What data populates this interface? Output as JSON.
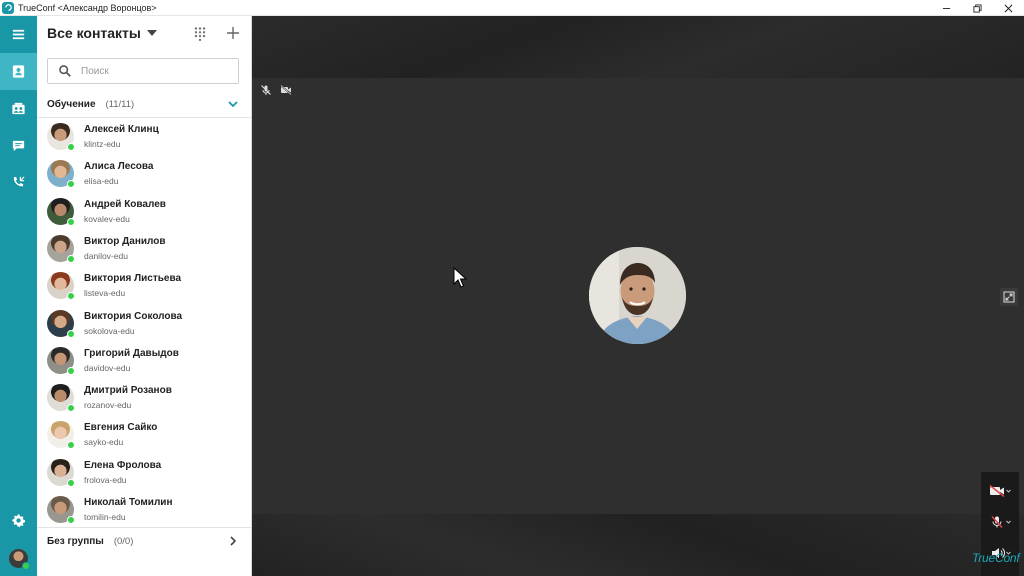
{
  "window": {
    "title": "TrueConf <Александр Воронцов>",
    "icons": [
      "trueconf-app-icon",
      "minimize-icon",
      "restore-icon",
      "close-icon"
    ]
  },
  "rail": {
    "items": [
      "menu-icon",
      "contacts-icon",
      "conferences-icon",
      "chat-icon",
      "call-history-icon",
      "settings-icon"
    ],
    "active": "contacts-icon",
    "accent": "#1a97a6",
    "active_bg": "#3eb6c4"
  },
  "contacts": {
    "header_title": "Все контакты",
    "search_placeholder": "Поиск",
    "groups": [
      {
        "name": "Обучение",
        "count": "(11/11)",
        "expanded": true
      },
      {
        "name": "Без группы",
        "count": "(0/0)",
        "expanded": false
      }
    ],
    "items": [
      {
        "name": "Алексей Клинц",
        "login": "klintz-edu",
        "status": "online"
      },
      {
        "name": "Алиса Лесова",
        "login": "elisa-edu",
        "status": "online"
      },
      {
        "name": "Андрей Ковалев",
        "login": "kovalev-edu",
        "status": "online"
      },
      {
        "name": "Виктор Данилов",
        "login": "danilov-edu",
        "status": "online"
      },
      {
        "name": "Виктория Листьева",
        "login": "listeva-edu",
        "status": "online"
      },
      {
        "name": "Виктория Соколова",
        "login": "sokolova-edu",
        "status": "online"
      },
      {
        "name": "Григорий Давыдов",
        "login": "davidov-edu",
        "status": "online"
      },
      {
        "name": "Дмитрий Розанов",
        "login": "rozanov-edu",
        "status": "online"
      },
      {
        "name": "Евгения Сайко",
        "login": "sayko-edu",
        "status": "online"
      },
      {
        "name": "Елена Фролова",
        "login": "frolova-edu",
        "status": "online"
      },
      {
        "name": "Николай Томилин",
        "login": "tomilin-edu",
        "status": "online"
      }
    ],
    "status_color": "#37d04a"
  },
  "call": {
    "indicators": [
      "mic-muted-icon",
      "camera-off-icon"
    ],
    "controls": [
      "camera-off-icon",
      "mic-muted-icon",
      "speaker-icon"
    ],
    "brand": "TrueConf"
  }
}
